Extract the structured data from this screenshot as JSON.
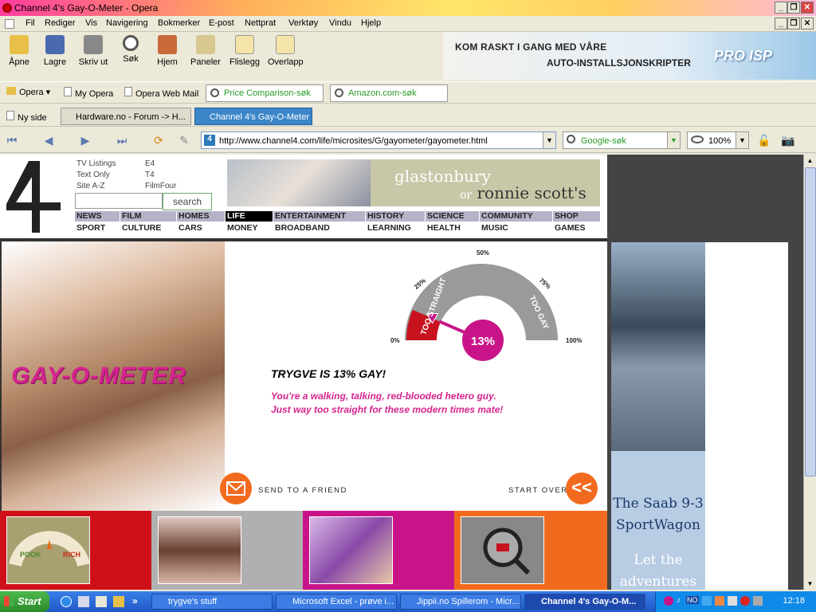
{
  "window": {
    "title": "Channel 4's Gay-O-Meter - Opera",
    "buttons": [
      "_",
      "❐",
      "✕"
    ]
  },
  "menu": [
    "Fil",
    "Rediger",
    "Vis",
    "Navigering",
    "Bokmerker",
    "E-post",
    "Nettprat",
    "Verktøy",
    "Vindu",
    "Hjelp"
  ],
  "toolbar": {
    "buttons": [
      "Åpne",
      "Lagre",
      "Skriv ut",
      "Søk",
      "Hjem",
      "Paneler",
      "Flislegg",
      "Overlapp"
    ]
  },
  "ad": {
    "line1": "KOM RASKT I GANG MED VÅRE",
    "line2": "AUTO-INSTALLSJONSKRIPTER",
    "brand": "PRO ISP"
  },
  "bookmarks": {
    "items": [
      "Opera",
      "My Opera",
      "Opera Web Mail"
    ],
    "search1": "Price Comparison-søk",
    "search2": "Amazon.com-søk"
  },
  "tabs": {
    "new_page": "Ny side",
    "items": [
      "Hardware.no - Forum -> H...",
      "Channel 4's Gay-O-Meter"
    ]
  },
  "address": {
    "url": "http://www.channel4.com/life/microsites/G/gayometer/gayometer.html",
    "search": "Google-søk",
    "zoom": "100%"
  },
  "c4": {
    "links_col1": [
      "TV Listings",
      "Text Only",
      "Site A-Z"
    ],
    "links_col2": [
      "E4",
      "T4",
      "FilmFour"
    ],
    "search_button": "search",
    "banner_line1": "glastonbury",
    "banner_or": "or",
    "banner_line2": "ronnie scott's",
    "nav_row1": [
      "NEWS",
      "FILM",
      "HOMES",
      "LIFE",
      "ENTERTAINMENT",
      "HISTORY",
      "SCIENCE",
      "COMMUNITY",
      "SHOP"
    ],
    "nav_row2": [
      "SPORT",
      "CULTURE",
      "CARS",
      "MONEY",
      "BROADBAND",
      "LEARNING",
      "HEALTH",
      "MUSIC",
      "GAMES"
    ]
  },
  "meter": {
    "title": "GAY-O-METER",
    "value": 13,
    "value_label": "13%",
    "ticks": [
      "0%",
      "25%",
      "50%",
      "75%",
      "100%"
    ],
    "left_label": "TOO STRAIGHT",
    "right_label": "TOO GAY",
    "result": "TRYGVE IS 13% GAY!",
    "description": "You're a walking, talking, red-blooded hetero guy. Just way too straight for these modern times mate!",
    "send": "SEND TO A FRIEND",
    "start_over": "START OVER",
    "start_over_icon": "<<"
  },
  "tile_meter": {
    "pook": "POOK",
    "rich": "RICH"
  },
  "colors": {
    "magenta": "#d6248e",
    "orange": "#f26a1e",
    "tile1": "#d01018",
    "tile2": "#b0b0b0",
    "tile3": "#c81488",
    "tile4": "#f26a1e"
  },
  "saab": {
    "line1": "The Saab 9-3 SportWagon",
    "line2": "Let the adventures"
  },
  "taskbar": {
    "start": "Start",
    "tasks": [
      "trygve's stuff",
      "Microsoft Excel - prøve i...",
      "Jippii.no Spillerom - Micr...",
      "Channel 4's Gay-O-M..."
    ],
    "clock": "12:18",
    "tray_label": "NO"
  }
}
